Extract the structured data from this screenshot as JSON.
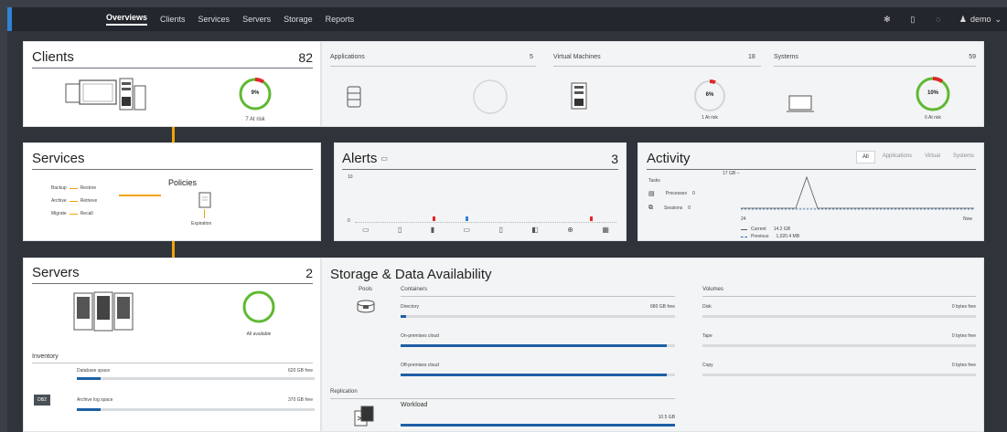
{
  "nav": {
    "items": [
      "Overviews",
      "Clients",
      "Services",
      "Servers",
      "Storage",
      "Reports"
    ],
    "active": "Overviews"
  },
  "user": {
    "name": "demo"
  },
  "clients": {
    "title": "Clients",
    "count": "82",
    "ring_pct": "9%",
    "risk": "7 At risk",
    "ring_value": 0.09
  },
  "summary": {
    "applications": {
      "label": "Applications",
      "count": "5"
    },
    "vms": {
      "label": "Virtual Machines",
      "count": "18",
      "ring_pct": "6%",
      "risk": "1 At risk",
      "ring_value": 0.06
    },
    "systems": {
      "label": "Systems",
      "count": "59",
      "ring_pct": "10%",
      "risk": "6 At risk",
      "ring_value": 0.1
    }
  },
  "services": {
    "title": "Services",
    "pairs": [
      {
        "left": "Backup",
        "right": "Restore"
      },
      {
        "left": "Archive",
        "right": "Retrieve"
      },
      {
        "left": "Migrate",
        "right": "Recall"
      }
    ],
    "policies_label": "Policies",
    "expiration_label": "Expiration"
  },
  "alerts": {
    "title": "Alerts",
    "count": "3",
    "y_label": "10",
    "y_zero": "0"
  },
  "activity": {
    "title": "Activity",
    "tabs": [
      "All",
      "Applications",
      "Virtual",
      "Systems"
    ],
    "active_tab": "All",
    "tasks_label": "Tasks",
    "processes": {
      "label": "Processes",
      "value": "0"
    },
    "sessions": {
      "label": "Sessions",
      "value": "0"
    },
    "y_top": "17 GB –",
    "x_start": "24",
    "x_end": "Now",
    "legend_current": {
      "label": "Current",
      "value": "14.2 GB"
    },
    "legend_previous": {
      "label": "Previous",
      "value": "1,020.4 MB"
    }
  },
  "servers": {
    "title": "Servers",
    "count": "2",
    "available": "All available",
    "inventory_label": "Inventory",
    "db_icon_label": "DB2",
    "rows": [
      {
        "label": "Database space",
        "value": "620 GB free",
        "fill": 0.1
      },
      {
        "label": "Archive log space",
        "value": "370 GB free",
        "fill": 0.1
      }
    ]
  },
  "storage": {
    "title": "Storage & Data Availability",
    "pools_label": "Pools",
    "containers_label": "Containers",
    "containers": [
      {
        "label": "Directory",
        "value": "680 GB free",
        "fill": 0.02
      },
      {
        "label": "On-premises cloud",
        "value": "",
        "fill": 0.97
      },
      {
        "label": "Off-premises cloud",
        "value": "",
        "fill": 0.97
      }
    ],
    "volumes_label": "Volumes",
    "volumes": [
      {
        "label": "Disk",
        "value": "0 bytes free"
      },
      {
        "label": "Tape",
        "value": "0 bytes free"
      },
      {
        "label": "Copy",
        "value": "0 bytes free"
      }
    ],
    "replication_label": "Replication",
    "workload_label": "Workload",
    "workload_value": "10.5 GB",
    "workload_fill": 1.0
  },
  "colors": {
    "accent": "#1e5fa6",
    "ring_green": "#5fb932",
    "risk_red": "#e0262a",
    "connector": "#f0a30a"
  }
}
